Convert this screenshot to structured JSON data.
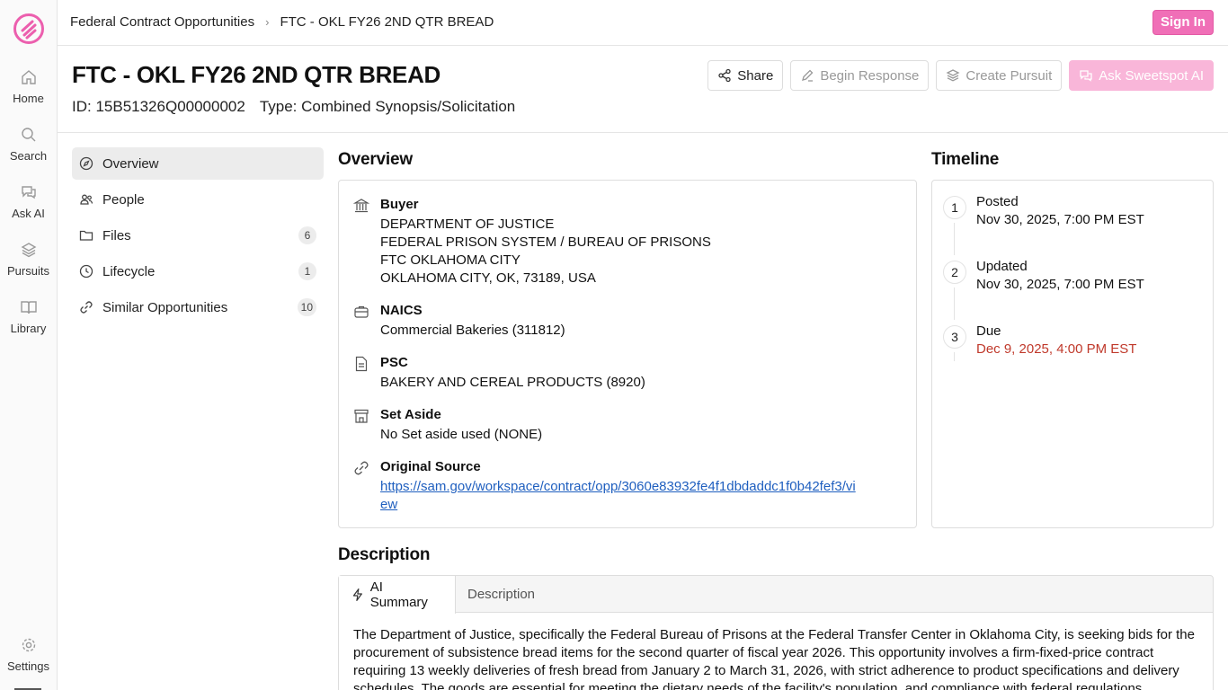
{
  "rail": {
    "items": [
      {
        "label": "Home"
      },
      {
        "label": "Search"
      },
      {
        "label": "Ask AI"
      },
      {
        "label": "Pursuits"
      },
      {
        "label": "Library"
      }
    ],
    "settings_label": "Settings"
  },
  "topbar": {
    "breadcrumb_root": "Federal Contract Opportunities",
    "breadcrumb_current": "FTC - OKL FY26 2ND QTR BREAD",
    "signin_label": "Sign In"
  },
  "header": {
    "title": "FTC - OKL FY26 2ND QTR BREAD",
    "id_text": "ID: 15B51326Q00000002",
    "type_text": "Type: Combined Synopsis/Solicitation",
    "actions": {
      "share": "Share",
      "begin_response": "Begin Response",
      "create_pursuit": "Create Pursuit",
      "ask_ai": "Ask Sweetspot AI"
    }
  },
  "sidenav": {
    "overview": "Overview",
    "people": "People",
    "files": "Files",
    "files_count": "6",
    "lifecycle": "Lifecycle",
    "lifecycle_count": "1",
    "similar": "Similar Opportunities",
    "similar_count": "10"
  },
  "overview": {
    "title": "Overview",
    "buyer_label": "Buyer",
    "buyer_lines": [
      "DEPARTMENT OF JUSTICE",
      "FEDERAL PRISON SYSTEM / BUREAU OF PRISONS",
      "FTC OKLAHOMA CITY",
      "OKLAHOMA CITY, OK, 73189, USA"
    ],
    "naics_label": "NAICS",
    "naics_value": "Commercial Bakeries (311812)",
    "psc_label": "PSC",
    "psc_value": "BAKERY AND CEREAL PRODUCTS (8920)",
    "setaside_label": "Set Aside",
    "setaside_value": "No Set aside used (NONE)",
    "source_label": "Original Source",
    "source_url": "https://sam.gov/workspace/contract/opp/3060e83932fe4f1dbdaddc1f0b42fef3/view"
  },
  "timeline": {
    "title": "Timeline",
    "items": [
      {
        "num": "1",
        "label": "Posted",
        "date": "Nov 30, 2025, 7:00 PM EST"
      },
      {
        "num": "2",
        "label": "Updated",
        "date": "Nov 30, 2025, 7:00 PM EST"
      },
      {
        "num": "3",
        "label": "Due",
        "date": "Dec 9, 2025, 4:00 PM EST"
      }
    ]
  },
  "description": {
    "title": "Description",
    "tab_ai": "AI Summary",
    "tab_desc": "Description",
    "body": "The Department of Justice, specifically the Federal Bureau of Prisons at the Federal Transfer Center in Oklahoma City, is seeking bids for the procurement of subsistence bread items for the second quarter of fiscal year 2026. This opportunity involves a firm-fixed-price contract requiring 13 weekly deliveries of fresh bread from January 2 to March 31, 2026, with strict adherence to product specifications and delivery schedules. The goods are essential for meeting the dietary needs of the facility's population, and compliance with federal regulations"
  },
  "colors": {
    "brand_pink": "#f06fb7",
    "due_red": "#c0392b",
    "link_blue": "#1f5fbf"
  }
}
